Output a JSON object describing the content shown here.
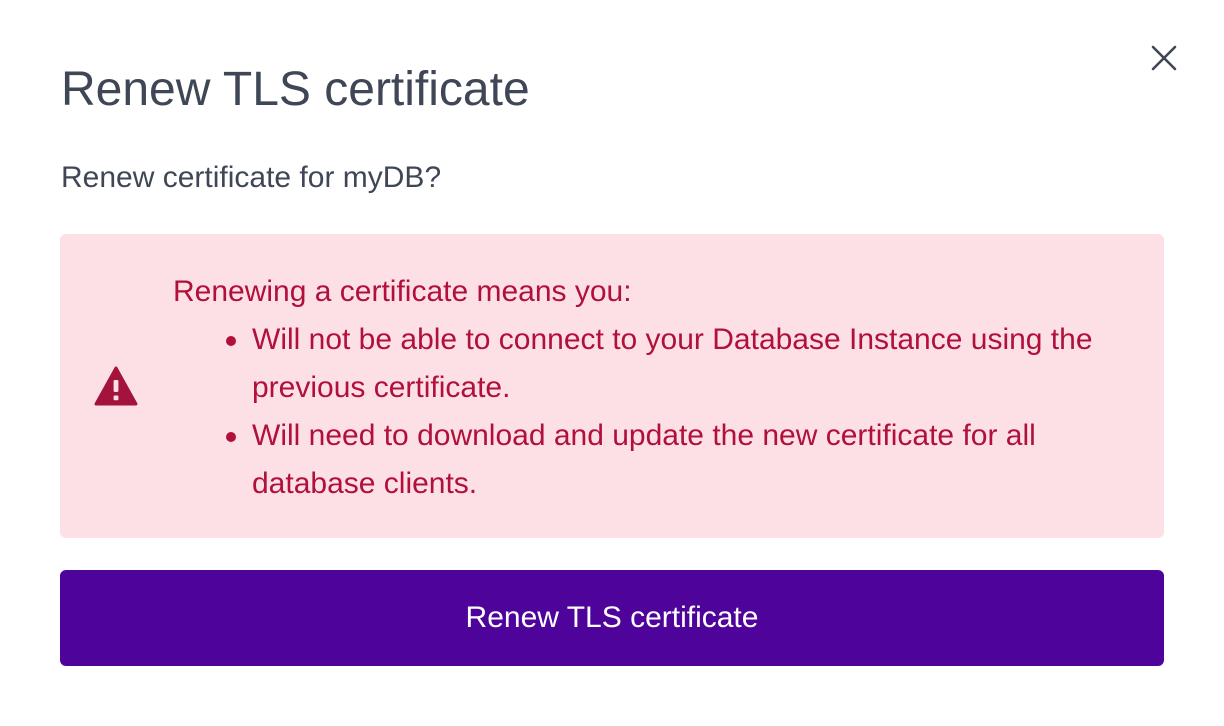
{
  "dialog": {
    "title": "Renew TLS certificate",
    "question": "Renew certificate for myDB?",
    "close_icon": "close-icon"
  },
  "alert": {
    "icon": "warning-triangle-icon",
    "intro": "Renewing a certificate means you:",
    "items": [
      "Will not be able to connect to your Database Instance using the previous certificate.",
      "Will need to download and update the new certificate for all database clients."
    ],
    "background_color": "#fde0e5",
    "text_color": "#b0103a"
  },
  "actions": {
    "primary_label": "Renew TLS certificate",
    "primary_color": "#4e049b"
  }
}
